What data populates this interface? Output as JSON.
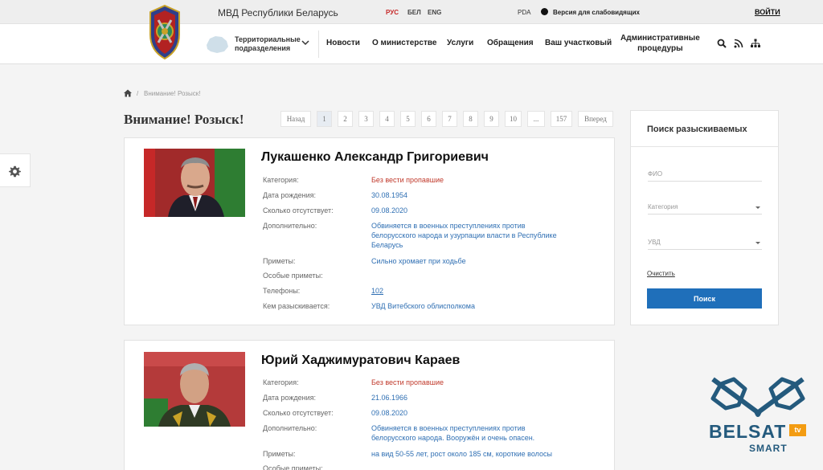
{
  "topbar": {
    "ministry": "МВД Республики Беларусь",
    "languages": [
      "РУС",
      "БЕЛ",
      "ENG"
    ],
    "pda": "PDA",
    "visually_impaired": "Версия для слабовидящих",
    "login": "ВОЙТИ"
  },
  "header": {
    "territorial_line1": "Территориальные",
    "territorial_line2": "подразделения",
    "nav": [
      "Новости",
      "О министерстве",
      "Услуги",
      "Обращения",
      "Ваш участковый"
    ],
    "nav_admin_line1": "Административные",
    "nav_admin_line2": "процедуры",
    "icons": [
      "search-icon",
      "rss-icon",
      "sitemap-icon"
    ]
  },
  "breadcrumb": {
    "sep": "/",
    "current": "Внимание! Розыск!"
  },
  "page_title": "Внимание! Розыск!",
  "pagination": {
    "prev": "Назад",
    "pages": [
      "1",
      "2",
      "3",
      "4",
      "5",
      "6",
      "7",
      "8",
      "9",
      "10",
      "...",
      "157"
    ],
    "active": "1",
    "next": "Вперед"
  },
  "labels": {
    "category": "Категория:",
    "birth_date": "Дата рождения:",
    "missing_since": "Сколько отсутствует:",
    "additional": "Дополнительно:",
    "signs": "Приметы:",
    "special_signs": "Особые приметы:",
    "phones": "Телефоны:",
    "searched_by": "Кем разыскивается:"
  },
  "persons": [
    {
      "name": "Лукашенко Александр Григориевич",
      "category": "Без вести пропавшие",
      "birth_date": "30.08.1954",
      "missing_since": "09.08.2020",
      "additional_lines": [
        "Обвиняется в военных преступлениях против",
        "белорусского народа и узурпации власти в Республике",
        "Беларусь"
      ],
      "signs": "Сильно хромает при ходьбе",
      "special_signs": "",
      "phones": "102",
      "searched_by": "УВД Витебского облисполкома"
    },
    {
      "name": "Юрий Хаджимуратович Караев",
      "category": "Без вести пропавшие",
      "birth_date": "21.06.1966",
      "missing_since": "09.08.2020",
      "additional_lines": [
        "Обвиняется в военных преступлениях против",
        "белорусского народа. Вооружён и очень опасен."
      ],
      "signs": "на вид 50-55 лет, рост около 185 см, короткие волосы",
      "special_signs": ""
    }
  ],
  "search_panel": {
    "title": "Поиск разыскиваемых",
    "fio_placeholder": "ФИО",
    "category_placeholder": "Категория",
    "uvd_placeholder": "УВД",
    "clear": "Очистить",
    "submit": "Поиск"
  },
  "watermark": {
    "brand": "BELSAT",
    "tv": "tv",
    "smart": "SMART"
  },
  "colors": {
    "accent": "#1f6fba",
    "link": "#2f6fb3",
    "alert": "#c0392b",
    "lang_active": "#c62828"
  }
}
